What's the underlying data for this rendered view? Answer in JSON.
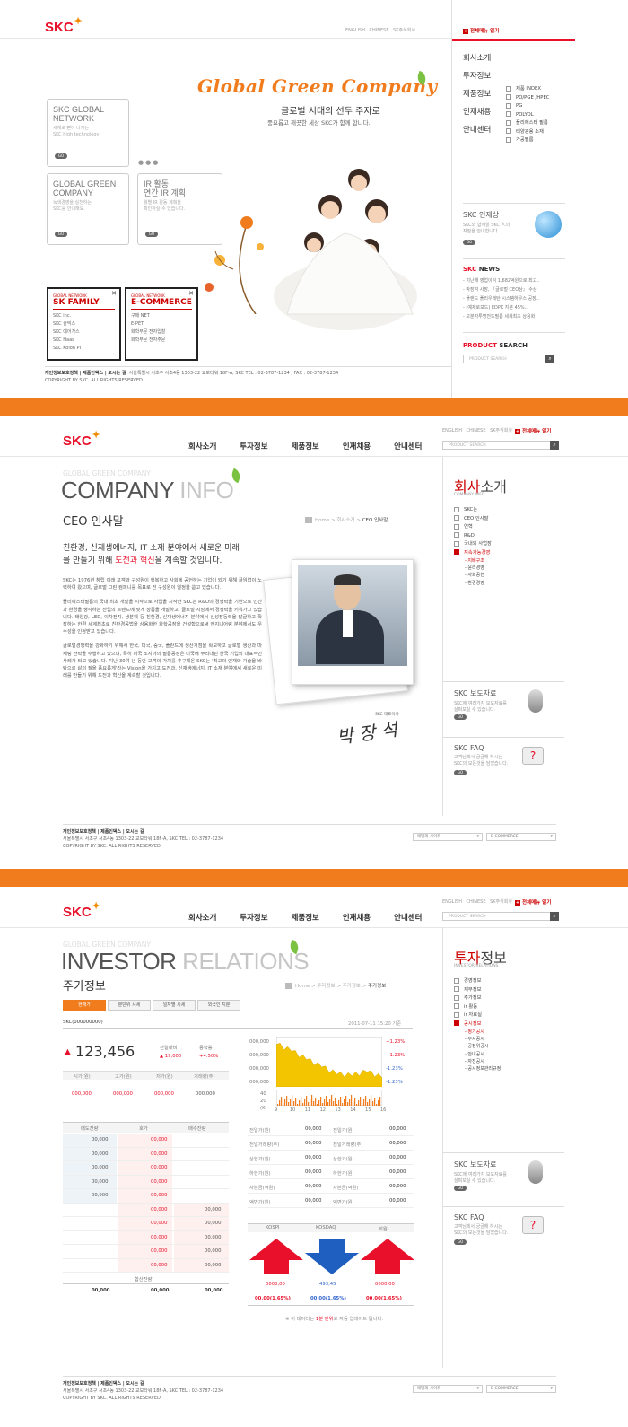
{
  "brand": {
    "logo": "SKC"
  },
  "colors": {
    "accent": "#e8102a",
    "orange": "#f07c1e",
    "up": "#e8102a",
    "down": "#3366cc"
  },
  "s1": {
    "toplinks": "ENGLISH CHINESE SK주식회사",
    "allmenu": "전체메뉴 열기",
    "nav": [
      "회사소개",
      "투자정보",
      "제품정보",
      "인재채용",
      "안내센터"
    ],
    "products": [
      "제품 INDEX",
      "PO/PGE /HPEC",
      "PG",
      "POLYOL",
      "폴리에스터 필름",
      "태양광용 소재",
      "가공필름"
    ],
    "hero_title": "Global Green Company",
    "hero_headline": "글로벌 시대의 선두 주자로",
    "hero_sub": "풍요롭고 깨끗한 세상 SKC가 함께 합니다.",
    "box_network_t1": "SKC GLOBAL",
    "box_network_t2": "NETWORK",
    "box_network_s1": "세계로 뻗어 나가는",
    "box_network_s2": "SKC high technology",
    "box_green_t1": "GLOBAL GREEN",
    "box_green_t2": "COMPANY",
    "box_green_s1": "녹색경영을 실천하는",
    "box_green_s2": "SKC를 안내해요.",
    "box_ir_t1": "IR 활동",
    "box_ir_t2": "연간 IR 계획",
    "box_ir_s1": "월별 IR 활동 계획을",
    "box_ir_s2": "확인하실 수 있습니다.",
    "go": "GO",
    "family_kicker": "GLOBAL NETWORK",
    "family_title": "SK FAMILY",
    "family_items": [
      "SKC inc.",
      "SKC 솔믹스",
      "SKC 에어가스",
      "SKC Haas",
      "SKC Kolon PI"
    ],
    "ecom_kicker": "GLOBAL NETWORK",
    "ecom_title": "E-COMMERCE",
    "ecom_items": [
      "구매 NET",
      "E-PET",
      "화학부문 전자입찰",
      "화학부문 전자주문"
    ],
    "talent_title": "SKC 인재상",
    "talent_s1": "SKC와 함께할 SKC 人의",
    "talent_s2": "자질을 안내합니다.",
    "news_brand": "SKC",
    "news_label": "NEWS",
    "news": [
      "- 지난해 영업이익 1,682억원으로 최고..",
      "- 박장석 사장, 『글로벌 CEO상』 수상",
      "- 플랜드 폴리우레탄 시스템하우스 공장..",
      "- (예제로보드) EDPK 지분 45%..",
      "- 고분자투명전도필름 세계최초 상용화"
    ],
    "ps_label": "PRODUCT SEARCH",
    "ps_brand": "PRODUCT",
    "ps_word": "SEARCH",
    "ps_placeholder": "PRODUCT SEARCH",
    "foot1": "개인정보보호정책 | 제품인덱스 | 오시는 길",
    "foot_addr": "서울특별시 서초구 서초4동 1303-22 교보타워 18F-A, SKC    TEL : 02-3787-1234 , FAX : 02-3787-1234",
    "copyright": "COPYRIGHT BY SKC. ALL RIGHTS RESERVED."
  },
  "s2": {
    "toplinks": "ENGLISH CHINESE SK주식회사",
    "allmenu": "전체메뉴 열기",
    "nav": [
      "회사소개",
      "투자정보",
      "제품정보",
      "인재채용",
      "안내센터"
    ],
    "search_placeholder": "PRODUCT SEARCH",
    "ghost": "GLOBAL GREEN COMPANY",
    "title_a": "COMPANY",
    "title_b": " INFO",
    "page_title": "CEO 인사말",
    "crumb_a": "Home > 회사소개 > ",
    "crumb_b": "CEO 인사말",
    "headline_1": "친환경, 신재생에너지, IT 소재 분야에서 새로운 미래",
    "headline_2a": "를 만들기 위해 ",
    "headline_2b": "도전과 혁신",
    "headline_2c": "을 계속할 것입니다.",
    "p1": "SKC는 1976년 창립 이래 고객과 구성원이 행복하고 사회에 공헌하는 기업이 되기 위해 끊임없이 노력하여 왔으며, 글로벌 그린 컴퍼니를 목표로 전 구성원이 열정을 쏟고 있습니다.",
    "p2": "폴리에스터필름의 국내 최초 개발을 시작으로 사업을 시작한 SKC는 R&D의 경쟁력을 기반으로 인간과 환경을 생각하는 산업의 트렌드에 맞게 상품을 개발하고, 글로벌 시장에서 경쟁력을 키워가고 있습니다. 태양광, LED, 이차전지, 생분해 등 친환경, 신재생에너지 분야에서 신성장동력을 발굴하고 확장하는 한편 세계최초로 친환경공법을 상용화한 화학공장을 건설함으로써 엔지니어링 분야에서도 우수성을 인정받고 있습니다.",
    "p3": "글로벌경쟁력을 강화하기 위해서 한국, 미국, 중국, 폴란드에 생산거점을 확보하고 글로벌 생산과 마케팅 전략을 수행하고 있으며, 특히 미국 조지아의 필름공장은 미국에 뿌리내린 한국 기업의 대표적인 사례가 되고 있습니다. 지난 30여 년 동안 고객의 가치를 추구해온 SKC는 '최고의 인재와 기술을 바탕으로 삶의 질을 풍요롭게'라는 Vision을 가지고 도전과, 신재생에너지, IT 소재 분야에서 새로운 미래를 만들기 위해 도전과 혁신을 계속할 것입니다.",
    "ceo_label": "SKC 대표이사",
    "signature": "박 장 석",
    "side_title_a": "회사",
    "side_title_b": "소개",
    "side_sub": "COMPANY INFO",
    "snav": [
      "SKC는",
      "CEO 인사말",
      "연혁",
      "R&D",
      "국내외 사업장",
      "지속가능경영"
    ],
    "snav_subs": [
      "- 지배구조",
      "- 윤리경영",
      "- 사회공헌",
      "- 환경경영"
    ],
    "w1_title": "SKC 보도자료",
    "w1_s1": "SKC에 여러가지 보도자료를",
    "w1_s2": "살펴보실 수 있습니다.",
    "w2_title": "SKC FAQ",
    "w2_s1": "고객님께서 궁금해 하시는",
    "w2_s2": "SKC의 모든것을 담았습니다.",
    "go": "GO",
    "foot1": "개인정보보호정책 | 제품인덱스 | 오시는 길",
    "foot_addr": "서울특별시 서초구 서초4동 1303-22 교보타워 18F-A, SKC    TEL : 02-3787-1234",
    "copyright": "COPYRIGHT BY SKC. ALL RIGHTS RESERVED.",
    "sel1": "패밀리 사이트",
    "sel2": "E-COMMERCE"
  },
  "s3": {
    "toplinks": "ENGLISH CHINESE SK주식회사",
    "allmenu": "전체메뉴 열기",
    "nav": [
      "회사소개",
      "투자정보",
      "제품정보",
      "인재채용",
      "안내센터"
    ],
    "search_placeholder": "PRODUCT SEARCH",
    "ghost": "GLOBAL GREEN COMPANY",
    "title_a": "INVESTOR",
    "title_b": " RELATIONS",
    "page_title": "주가정보",
    "crumb_a": "Home > 투자정보 > 주가정보 > ",
    "crumb_b": "주가정보",
    "tabs": [
      "현재가",
      "분단위 시세",
      "일자별 시세",
      "외국인 지분"
    ],
    "stock_name": "SKC(000000000)",
    "timestamp": "2011-07-11   15:20 기준",
    "price": "123,456",
    "chg_label": "전일대비",
    "chg_value": "19,000",
    "rate_label": "등락률",
    "rate_value": "4.50%",
    "ohlc_labels": [
      "시가(원)",
      "고가(원)",
      "저가(원)",
      "거래량(주)"
    ],
    "ohlc_values": [
      "000,000",
      "000,000",
      "000,000",
      "000,000"
    ],
    "chart_y": [
      "000,000",
      "000,000",
      "000,000",
      "000,000"
    ],
    "chart_pct": [
      "+1.23%",
      "+1.23%",
      "-1.23%",
      "-1.23%"
    ],
    "vol_y": [
      "40",
      "20",
      "(K)"
    ],
    "chart_x": [
      "9",
      "10",
      "11",
      "12",
      "13",
      "14",
      "15",
      "16"
    ],
    "ob_head": [
      "매도잔량",
      "호가",
      "매수잔량"
    ],
    "ob_sell": [
      "00,000",
      "00,000",
      "00,000",
      "00,000",
      "00,000"
    ],
    "ob_sell_px": [
      "00,000",
      "00,000",
      "00,000",
      "00,000",
      "00,000"
    ],
    "ob_buy_px": [
      "00,000",
      "00,000",
      "00,000",
      "00,000",
      "00,000"
    ],
    "ob_buy": [
      "00,000",
      "00,000",
      "00,000",
      "00,000",
      "00,000"
    ],
    "ob_total_label": "합산잔량",
    "ob_totals": [
      "00,000",
      "00,000",
      "00,000"
    ],
    "info_labels_l": [
      "전일가(원)",
      "전일거래량(주)",
      "상한가(원)",
      "하한가(원)",
      "자본금(억원)",
      "액면가(원)"
    ],
    "info_vals_l": [
      "00,000",
      "00,000",
      "00,000",
      "00,000",
      "00,000",
      "00,000"
    ],
    "info_labels_r": [
      "전일가(원)",
      "전일거래량(주)",
      "상한가(원)",
      "하한가(원)",
      "자본금(억원)",
      "액면가(원)"
    ],
    "info_vals_r": [
      "00,000",
      "00,000",
      "00,000",
      "00,000",
      "00,000",
      "00,000"
    ],
    "idx_labels": [
      "KOSPI",
      "KOSDAQ",
      "회원"
    ],
    "idx_vals": [
      "0000,00",
      "493,45",
      "0000,00"
    ],
    "idx_chg": [
      "00,00(1,65%)",
      "00,00(1,65%)",
      "00,00(1,65%)"
    ],
    "note_a": "※ 이 데이터는 ",
    "note_b": "1분 단위",
    "note_c": "로 자동 업데이트 됩니다.",
    "side_title_a": "투자",
    "side_title_b": "정보",
    "side_sub": "INVESTOR RELATIONS",
    "snav": [
      "경영정보",
      "재무정보",
      "주가정보",
      "ir 활동",
      "ir 자료실",
      "공시정보"
    ],
    "snav_subs": [
      "- 정기공시",
      "- 수시공시",
      "- 공정위공시",
      "- 안내공시",
      "- 자진공시",
      "- 공시정보관리규정"
    ],
    "w1_title": "SKC 보도자료",
    "w1_s1": "SKC에 여러가지 보도자료를",
    "w1_s2": "살펴보실 수 있습니다.",
    "w2_title": "SKC FAQ",
    "w2_s1": "고객님께서 궁금해 하시는",
    "w2_s2": "SKC의 모든것을 담았습니다.",
    "go": "GO",
    "foot1": "개인정보보호정책 | 제품인덱스 | 오시는 길",
    "foot_addr": "서울특별시 서초구 서초4동 1303-22 교보타워 18F-A, SKC    TEL : 02-3787-1234",
    "copyright": "COPYRIGHT BY SKC. ALL RIGHTS RESERVED.",
    "sel1": "패밀리 사이트",
    "sel2": "E-COMMERCE"
  },
  "chart_data": {
    "type": "area",
    "x": [
      "9",
      "10",
      "11",
      "12",
      "13",
      "14",
      "15",
      "16"
    ],
    "series": [
      {
        "values": [
          0.86,
          0.72,
          0.55,
          0.4,
          0.25,
          0.22,
          0.3,
          0.18
        ]
      }
    ]
  }
}
